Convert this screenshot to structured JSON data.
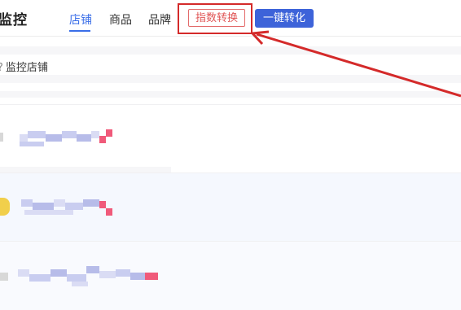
{
  "header": {
    "title": "监控",
    "tabs": [
      {
        "label": "店铺",
        "active": true
      },
      {
        "label": "商品",
        "active": false
      },
      {
        "label": "品牌",
        "active": false
      }
    ],
    "convert_button_label": "指数转换",
    "one_click_button_label": "一键转化"
  },
  "section": {
    "label": "监控店铺"
  },
  "colors": {
    "accent": "#3a6ee8",
    "primary_button": "#3d63d9",
    "highlight_red": "#d42a2a"
  },
  "icons": {
    "help": "question-mark",
    "annotation": "red-arrow"
  }
}
